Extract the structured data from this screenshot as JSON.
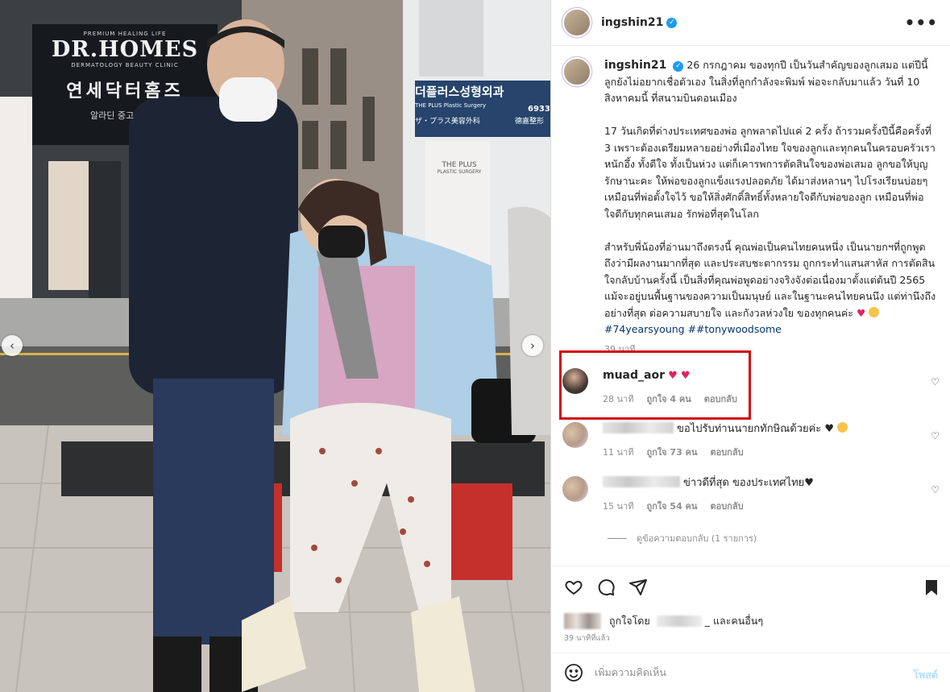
{
  "post": {
    "username": "ingshin21",
    "more_label": "•••",
    "caption": "26 กรกฎาคม ของทุกปี เป็นวันสำคัญของลูกเสมอ แต่ปีนี้ลูกยังไม่อยากเชื่อตัวเอง ในสิ่งที่ลูกกำลังจะพิมพ์ พ่อจะกลับมาแล้ว วันที่ 10 สิงหาคมนี้ ที่สนามบินดอนเมือง\n\n17 วันเกิดที่ต่างประเทศของพ่อ ลูกพลาดไปแค่ 2 ครั้ง ถ้ารวมครั้งปีนี้คือครั้งที่ 3 เพราะต้องเตรียมหลายอย่างที่เมืองไทย ใจของลูกและทุกคนในครอบครัวเราหนักอึ้ง ทั้งดีใจ ทั้งเป็นห่วง แต่ก็เคารพการตัดสินใจของพ่อเสมอ ลูกขอให้บุญรักษานะคะ ให้พ่อของลูกแข็งแรงปลอดภัย ได้มาส่งหลานๆ ไปโรงเรียนบ่อยๆ เหมือนที่พ่อตั้งใจไว้ ขอให้สิ่งศักดิ์สิทธิ์ทั้งหลายใจดีกับพ่อของลูก เหมือนที่พ่อใจดีกับทุกคนเสมอ รักพ่อที่สุดในโลก\n\nสำหรับพี่น้องที่อ่านมาถึงตรงนี้ คุณพ่อเป็นคนไทยคนหนึ่ง เป็นนายกฯที่ถูกพูดถึงว่ามีผลงานมากที่สุด และประสบชะตากรรม ถูกกระทำแสนสาหัส การตัดสินใจกลับบ้านครั้งนี้ เป็นสิ่งที่คุณพ่อพูดอย่างจริงจังต่อเนื่องมาตั้งแต่ต้นปี 2565 แม้จะอยู่บนพื้นฐานของความเป็นมนุษย์ และในฐานะคนไทยคนนึง แต่ท่านึงถึงอย่างที่สุด ต่อความสบายใจ และกังวลห่วงใย ของทุกคนค่ะ",
    "caption_emoji_heart": "♥",
    "hashtags": "#74yearsyoung ##tonywoodsome",
    "caption_time": "39 นาที"
  },
  "comments": [
    {
      "username": "muad_aor",
      "text": "♥ ♥",
      "time": "28 นาที",
      "likes": "ถูกใจ 4 คน",
      "reply": "ตอบกลับ"
    },
    {
      "username": "",
      "text": "ขอไปรับท่านนายกทักษิณด้วยค่ะ ♥",
      "time": "11 นาที",
      "likes": "ถูกใจ 73 คน",
      "reply": "ตอบกลับ"
    },
    {
      "username": "",
      "text": "ข่าวดีที่สุด ของประเทศไทย♥",
      "time": "15 นาที",
      "likes": "ถูกใจ 54 คน",
      "reply": "ตอบกลับ"
    }
  ],
  "view_replies": "ดูข้อความตอบกลับ (1 รายการ)",
  "likes_line": {
    "prefix": "ถูกใจโดย",
    "suffix": "_ และคนอื่นๆ"
  },
  "post_time": "39 นาทีที่แล้ว",
  "add_comment": {
    "placeholder": "เพิ่มความคิดเห็น",
    "post_label": "โพสต์"
  },
  "photo": {
    "signs": {
      "premium": "PREMIUM HEALING LIFE",
      "brand": "DR.HOMES",
      "sub": "DERMATOLOGY BEAUTY CLINIC",
      "korean": "연세닥터홈즈",
      "aladdin": "알라딘 중고",
      "plus_korean": "더플러스성형외과",
      "plus_en": "THE PLUS Plastic Surgery",
      "plus_jp": "ザ・プラス美容外科",
      "plus_cn": "德嘉整形",
      "plus_phone": "6933-",
      "plus_board": "THE PLUS",
      "plus_board_sub": "PLASTIC SURGERY"
    },
    "carousel_prev": "‹",
    "carousel_next": "›"
  },
  "colors": {
    "highlight": "#d10a0a",
    "hashtag": "#00376b",
    "verified": "#1d9bf0",
    "post_button": "#b2dffc"
  }
}
